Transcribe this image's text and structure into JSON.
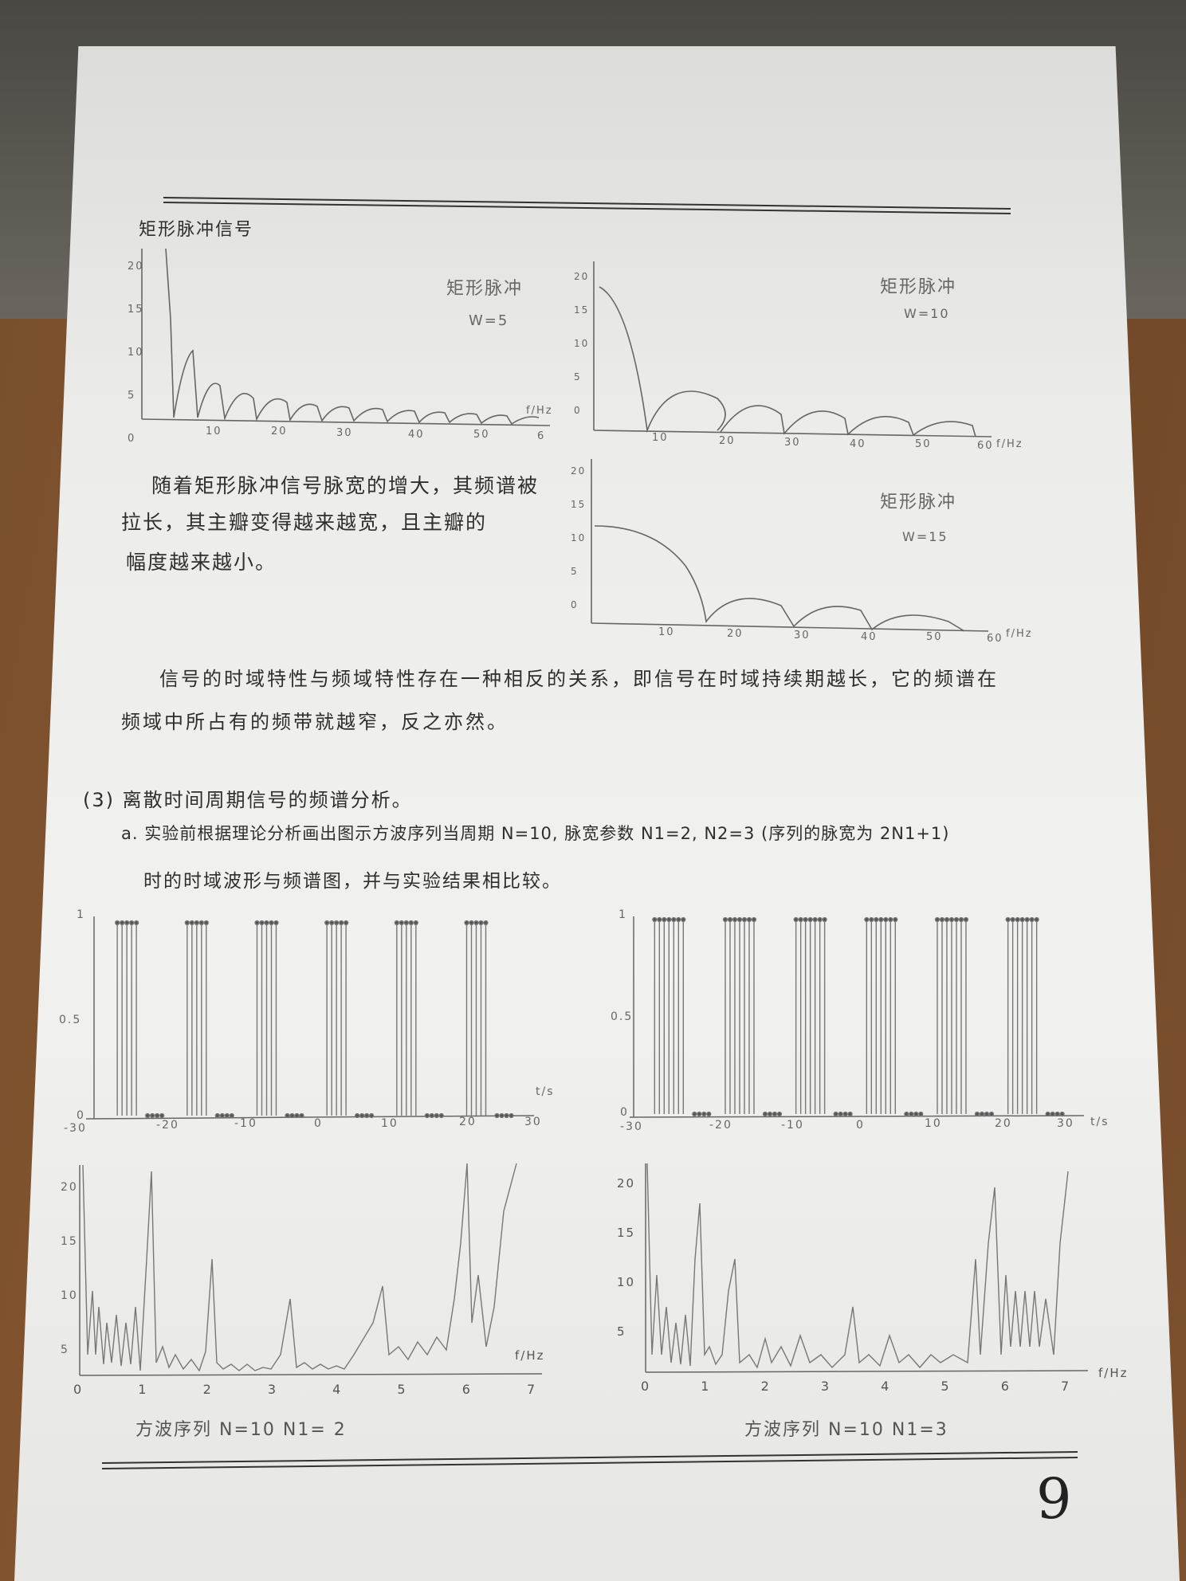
{
  "page_number": "9",
  "chart1": {
    "section_title": "矩形脉冲信号",
    "y_ticks": [
      "20",
      "15",
      "10",
      "5",
      "0"
    ],
    "x_ticks": [
      "10",
      "20",
      "30",
      "40",
      "50",
      "6"
    ],
    "x_unit": "f/Hz",
    "label": "矩形脉冲",
    "param": "W=5"
  },
  "chart2": {
    "y_ticks": [
      "20",
      "15",
      "10",
      "5",
      "0"
    ],
    "x_ticks": [
      "10",
      "20",
      "30",
      "40",
      "50",
      "60"
    ],
    "x_unit": "f/Hz",
    "label": "矩形脉冲",
    "param": "W=10"
  },
  "chart3": {
    "y_ticks": [
      "20",
      "15",
      "10",
      "5",
      "0"
    ],
    "x_ticks": [
      "10",
      "20",
      "30",
      "40",
      "50",
      "60"
    ],
    "x_unit": "f/Hz",
    "label": "矩形脉冲",
    "param": "W=15"
  },
  "paragraph1": [
    "随着矩形脉冲信号脉宽的增大，其频谱被",
    "拉长，其主瓣变得越来越宽，且主瓣的",
    "幅度越来越小。"
  ],
  "paragraph2": [
    "信号的时域特性与频域特性存在一种相反的关系，即信号在时域持续期越长，它的频谱在",
    "频域中所占有的频带就越窄，反之亦然。"
  ],
  "section3": {
    "heading": "(3) 离散时间周期信号的频谱分析。",
    "item_a_line1": "a. 实验前根据理论分析画出图示方波序列当周期 N=10, 脉宽参数 N1=2, N2=3 (序列的脉宽为 2N1+1)",
    "item_a_line2": "时的时域波形与频谱图，并与实验结果相比较。"
  },
  "stem_left": {
    "y_ticks": [
      "1",
      "0.5",
      "0"
    ],
    "x_ticks": [
      "-30",
      "-20",
      "-10",
      "0",
      "10",
      "20",
      "30"
    ],
    "x_unit": "t/s"
  },
  "stem_right": {
    "y_ticks": [
      "1",
      "0.5",
      "0"
    ],
    "x_ticks": [
      "-30",
      "-20",
      "-10",
      "0",
      "10",
      "20",
      "30"
    ],
    "x_unit": "t/s"
  },
  "spec_left": {
    "y_ticks": [
      "20",
      "15",
      "10",
      "5"
    ],
    "x_ticks": [
      "0",
      "1",
      "2",
      "3",
      "4",
      "5",
      "6",
      "7"
    ],
    "x_unit": "f/Hz",
    "caption": "方波序列   N=10   N1= 2"
  },
  "spec_right": {
    "y_ticks": [
      "20",
      "15",
      "10",
      "5"
    ],
    "x_ticks": [
      "0",
      "1",
      "2",
      "3",
      "4",
      "5",
      "6",
      "7"
    ],
    "x_unit": "f/Hz",
    "caption": "方波序列   N=10   N1=3"
  },
  "colors": {
    "ink": "#2e2e2e",
    "pencil": "#6a6a6a",
    "rule": "#333333"
  }
}
